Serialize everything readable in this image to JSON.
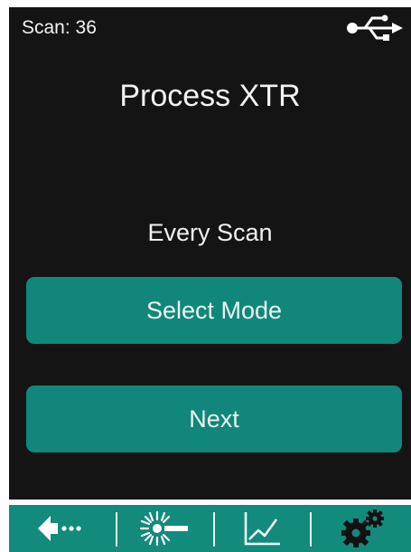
{
  "status_bar": {
    "scan_count": "Scan: 36",
    "usb_icon": "usb-icon"
  },
  "title": "Process XTR",
  "mode": {
    "current_value": "Every Scan"
  },
  "buttons": {
    "select_mode": "Select Mode",
    "next": "Next"
  },
  "navbar": {
    "items": [
      {
        "icon": "back-arrow-icon"
      },
      {
        "icon": "laser-icon"
      },
      {
        "icon": "chart-icon"
      },
      {
        "icon": "settings-gears-icon"
      }
    ]
  },
  "colors": {
    "background": "#141414",
    "accent": "#10877a",
    "navbar": "#128a7c",
    "text": "#f2f2f2"
  }
}
